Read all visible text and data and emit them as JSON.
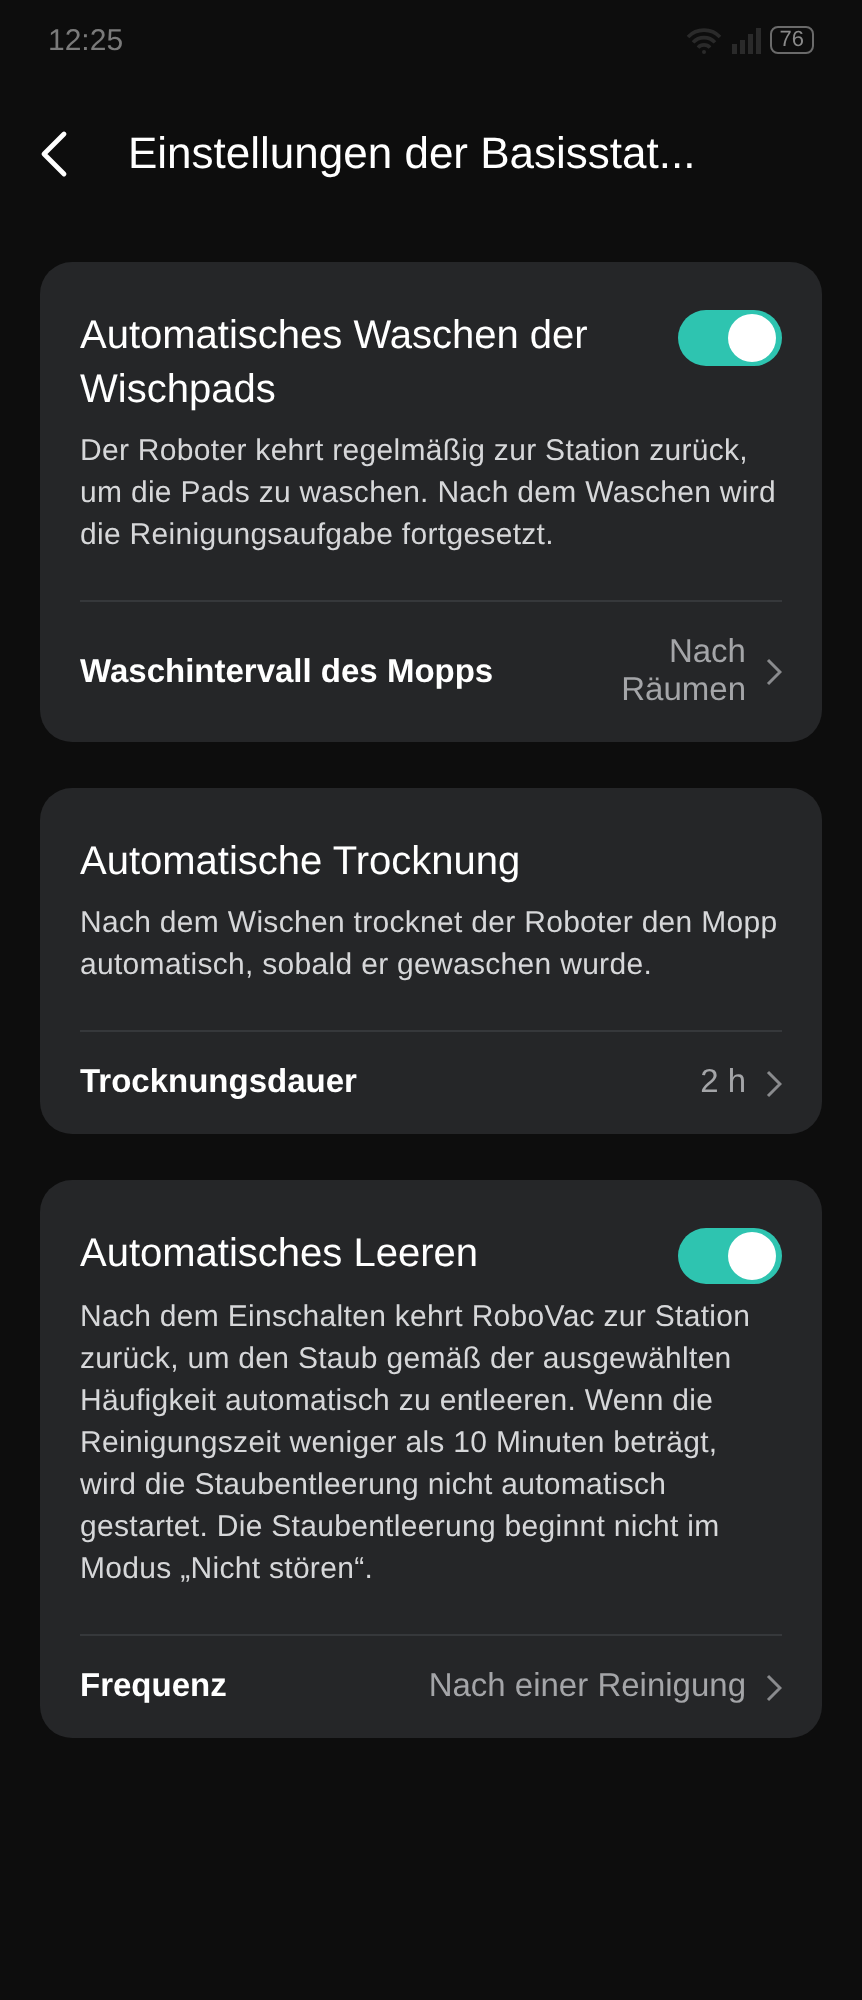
{
  "status_bar": {
    "time": "12:25",
    "battery": "76"
  },
  "header": {
    "title": "Einstellungen der Basisstat..."
  },
  "cards": [
    {
      "title": "Automatisches Waschen der Wischpads",
      "on": true,
      "description": "Der Roboter kehrt regelmäßig zur Station zurück, um die Pads zu waschen. Nach dem Waschen wird die Reinigungsaufgabe fortgesetzt.",
      "row": {
        "label": "Waschintervall des Mopps",
        "value": "Nach Räumen"
      }
    },
    {
      "title": "Automatische Trocknung",
      "description": "Nach dem Wischen trocknet der Roboter den Mopp automatisch, sobald er gewaschen wurde.",
      "row": {
        "label": "Trocknungsdauer",
        "value": "2 h"
      }
    },
    {
      "title": "Automatisches Leeren",
      "on": true,
      "description": "Nach dem Einschalten kehrt RoboVac zur Station zurück, um den Staub gemäß der ausgewählten Häufigkeit automatisch zu entleeren. Wenn die Reinigungszeit weniger als 10 Minuten beträgt, wird die Staubentleerung nicht automatisch gestartet. Die Staubentleerung beginnt nicht im Modus „Nicht stören“.",
      "row": {
        "label": "Frequenz",
        "value": "Nach einer Reinigung"
      }
    }
  ]
}
